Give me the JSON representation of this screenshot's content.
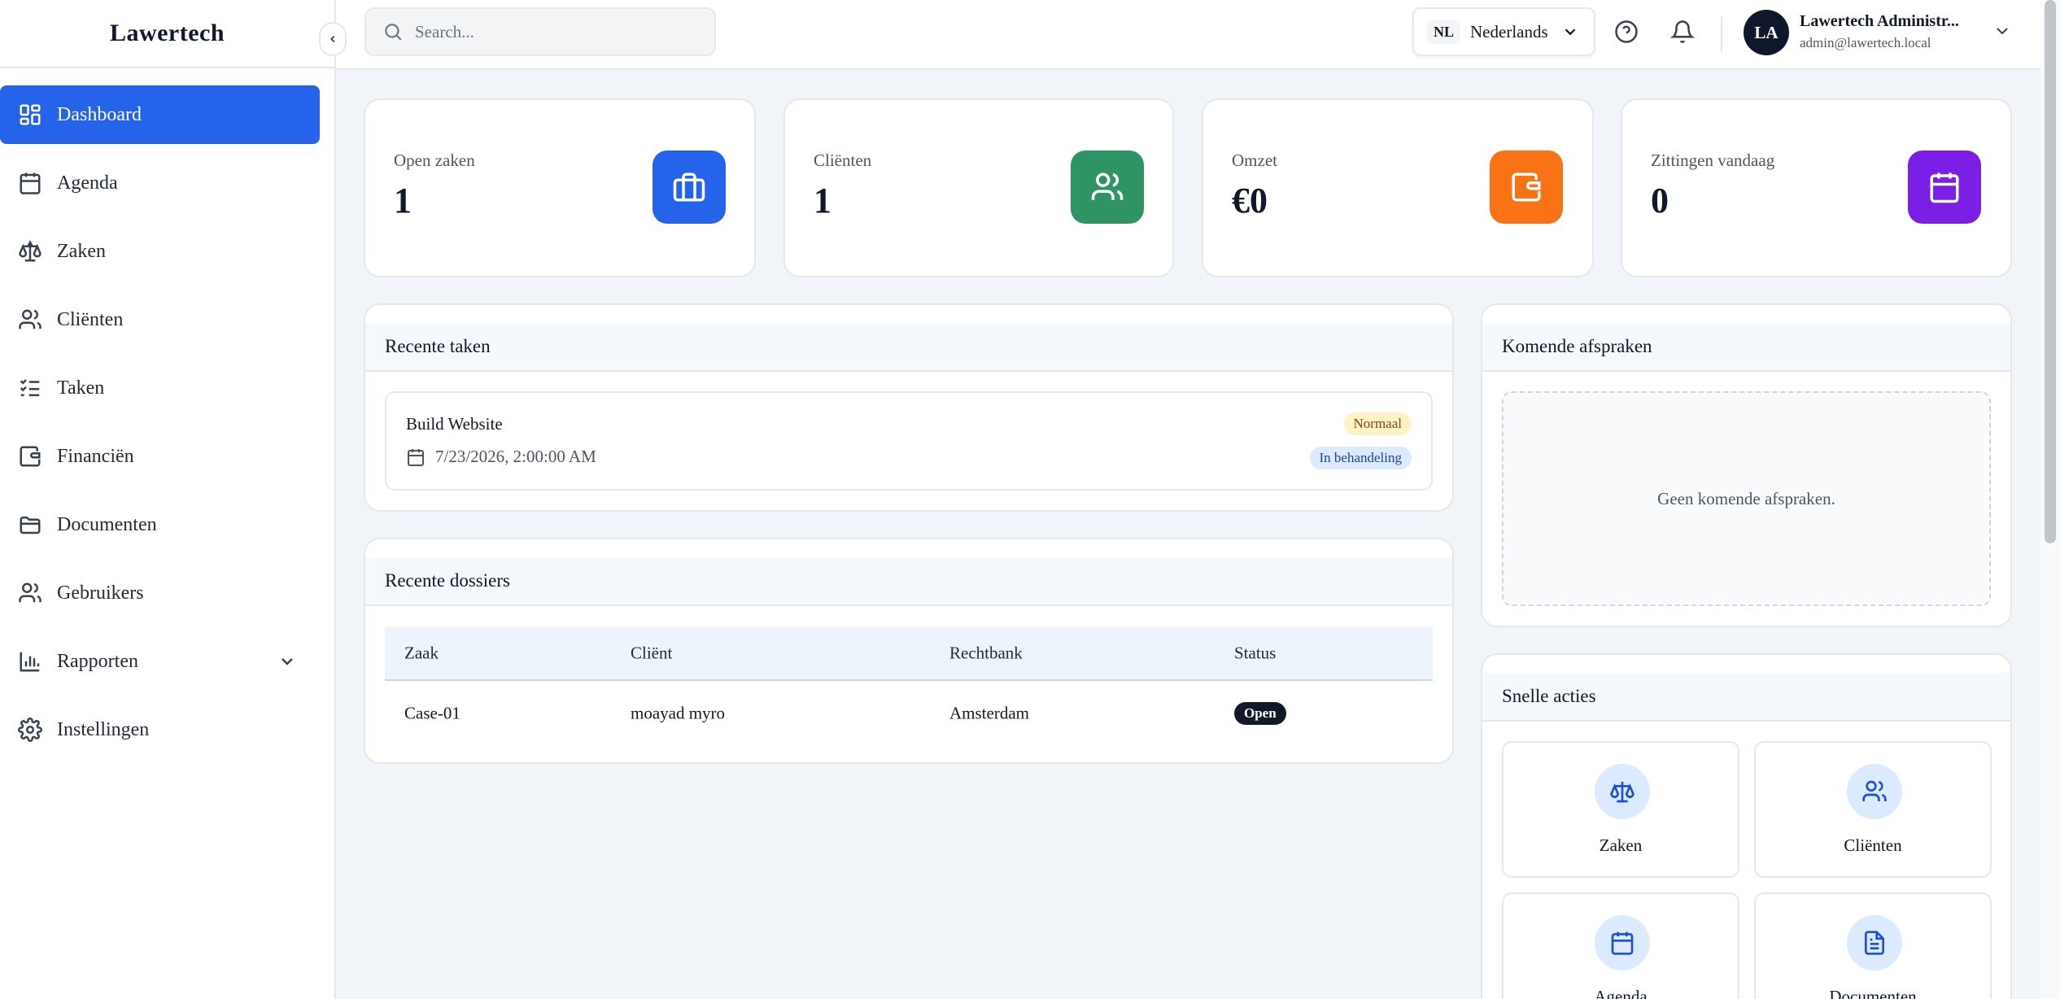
{
  "app": {
    "brand": "Lawertech"
  },
  "sidebar": {
    "items": [
      {
        "label": "Dashboard",
        "icon": "dashboard-icon"
      },
      {
        "label": "Agenda",
        "icon": "calendar-icon"
      },
      {
        "label": "Zaken",
        "icon": "scale-icon"
      },
      {
        "label": "Cliënten",
        "icon": "users-icon"
      },
      {
        "label": "Taken",
        "icon": "tasks-icon"
      },
      {
        "label": "Financiën",
        "icon": "wallet-icon"
      },
      {
        "label": "Documenten",
        "icon": "folder-icon"
      },
      {
        "label": "Gebruikers",
        "icon": "users-icon"
      },
      {
        "label": "Rapporten",
        "icon": "bar-chart-icon"
      },
      {
        "label": "Instellingen",
        "icon": "gear-icon"
      }
    ]
  },
  "topbar": {
    "search": {
      "placeholder": "Search...",
      "value": ""
    },
    "language": {
      "code": "NL",
      "label": "Nederlands"
    },
    "user": {
      "initials": "LA",
      "name": "Lawertech Administr...",
      "email": "admin@lawertech.local"
    }
  },
  "stats": [
    {
      "label": "Open zaken",
      "value": "1",
      "icon": "briefcase-icon",
      "color": "#2563eb"
    },
    {
      "label": "Cliënten",
      "value": "1",
      "icon": "users-icon",
      "color": "#2f9464"
    },
    {
      "label": "Omzet",
      "value": "€0",
      "icon": "wallet-icon",
      "color": "#f97316"
    },
    {
      "label": "Zittingen vandaag",
      "value": "0",
      "icon": "calendar-icon",
      "color": "#7c1fe6"
    }
  ],
  "recent_tasks": {
    "title": "Recente taken",
    "items": [
      {
        "title": "Build Website",
        "date": "7/23/2026, 2:00:00 AM",
        "priority": "Normaal",
        "status": "In behandeling"
      }
    ]
  },
  "recent_cases": {
    "title": "Recente dossiers",
    "columns": [
      "Zaak",
      "Cliënt",
      "Rechtbank",
      "Status"
    ],
    "rows": [
      {
        "zaak": "Case-01",
        "client": "moayad myro",
        "rechtbank": "Amsterdam",
        "status": "Open"
      }
    ]
  },
  "upcoming": {
    "title": "Komende afspraken",
    "empty": "Geen komende afspraken."
  },
  "quick_actions": {
    "title": "Snelle acties",
    "items": [
      {
        "label": "Zaken",
        "icon": "scale-icon"
      },
      {
        "label": "Cliënten",
        "icon": "users-icon"
      },
      {
        "label": "Agenda",
        "icon": "calendar-icon"
      },
      {
        "label": "Documenten",
        "icon": "document-icon"
      }
    ]
  }
}
